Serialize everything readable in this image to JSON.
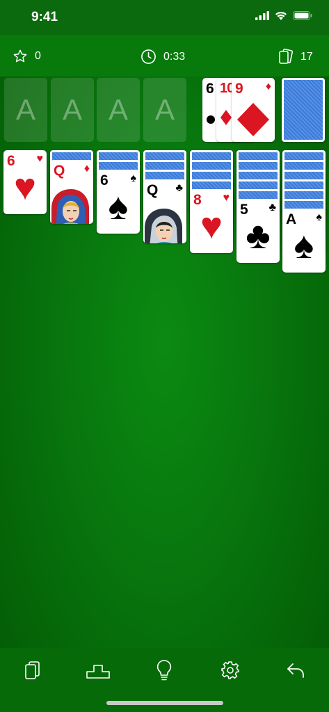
{
  "status": {
    "time": "9:41"
  },
  "hud": {
    "score": "0",
    "time": "0:33",
    "moves": "17"
  },
  "foundations": [
    "A",
    "A",
    "A",
    "A"
  ],
  "waste": [
    {
      "rank": "6",
      "suit": "♣",
      "color": "black"
    },
    {
      "rank": "10",
      "suit": "♦",
      "color": "red"
    },
    {
      "rank": "9",
      "suit": "♦",
      "color": "red"
    }
  ],
  "tableau": [
    {
      "facedown": 0,
      "rank": "6",
      "suit": "♥",
      "color": "red",
      "type": "pip"
    },
    {
      "facedown": 1,
      "rank": "Q",
      "suit": "♦",
      "color": "red",
      "type": "queen"
    },
    {
      "facedown": 2,
      "rank": "6",
      "suit": "♠",
      "color": "black",
      "type": "pip"
    },
    {
      "facedown": 3,
      "rank": "Q",
      "suit": "♣",
      "color": "black",
      "type": "queen"
    },
    {
      "facedown": 4,
      "rank": "8",
      "suit": "♥",
      "color": "red",
      "type": "pip"
    },
    {
      "facedown": 5,
      "rank": "5",
      "suit": "♣",
      "color": "black",
      "type": "pip"
    },
    {
      "facedown": 6,
      "rank": "A",
      "suit": "♠",
      "color": "black",
      "type": "pip"
    }
  ],
  "toolbar": [
    "cards-icon",
    "podium-icon",
    "hint-icon",
    "settings-icon",
    "undo-icon"
  ]
}
